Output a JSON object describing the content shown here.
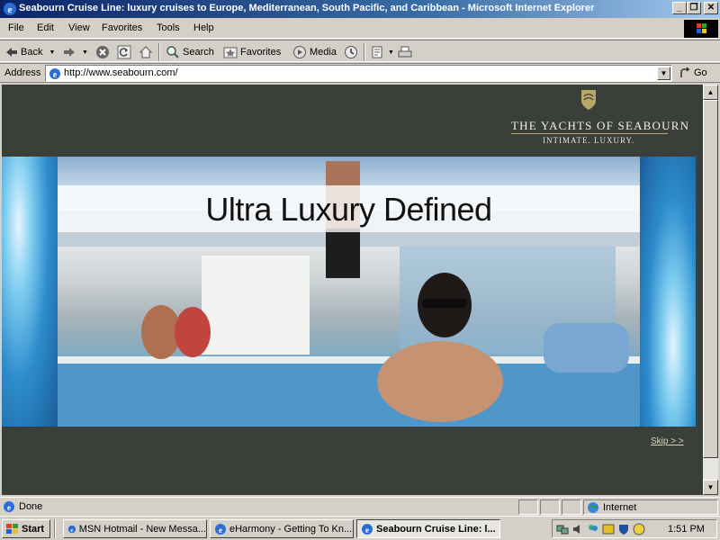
{
  "window": {
    "title": "Seabourn Cruise Line: luxury cruises to Europe, Mediterranean, South Pacific, and Caribbean - Microsoft Internet Explorer",
    "minimize": "_",
    "maximize": "❐",
    "close": "✕"
  },
  "menu": [
    "File",
    "Edit",
    "View",
    "Favorites",
    "Tools",
    "Help"
  ],
  "toolbar": {
    "back": "Back",
    "search": "Search",
    "favorites": "Favorites",
    "media": "Media"
  },
  "address": {
    "label": "Address",
    "url": "http://www.seabourn.com/",
    "go": "Go"
  },
  "page": {
    "brand_title": "THE YACHTS OF SEABOURN",
    "brand_sub": "INTIMATE. LUXURY.",
    "headline": "Ultra Luxury Defined",
    "skip": "Skip > >"
  },
  "status": {
    "text": "Done",
    "zone": "Internet"
  },
  "taskbar": {
    "start": "Start",
    "tasks": [
      {
        "label": "MSN Hotmail - New Messa..."
      },
      {
        "label": "eHarmony - Getting To Kn..."
      },
      {
        "label": "Seabourn Cruise Line: l..."
      }
    ],
    "clock": "1:51 PM"
  },
  "colors": {
    "title_bar_start": "#0a246a",
    "chrome": "#d4d0c8",
    "page_background": "#3b3f3a",
    "brand_gold": "#b8a766"
  }
}
